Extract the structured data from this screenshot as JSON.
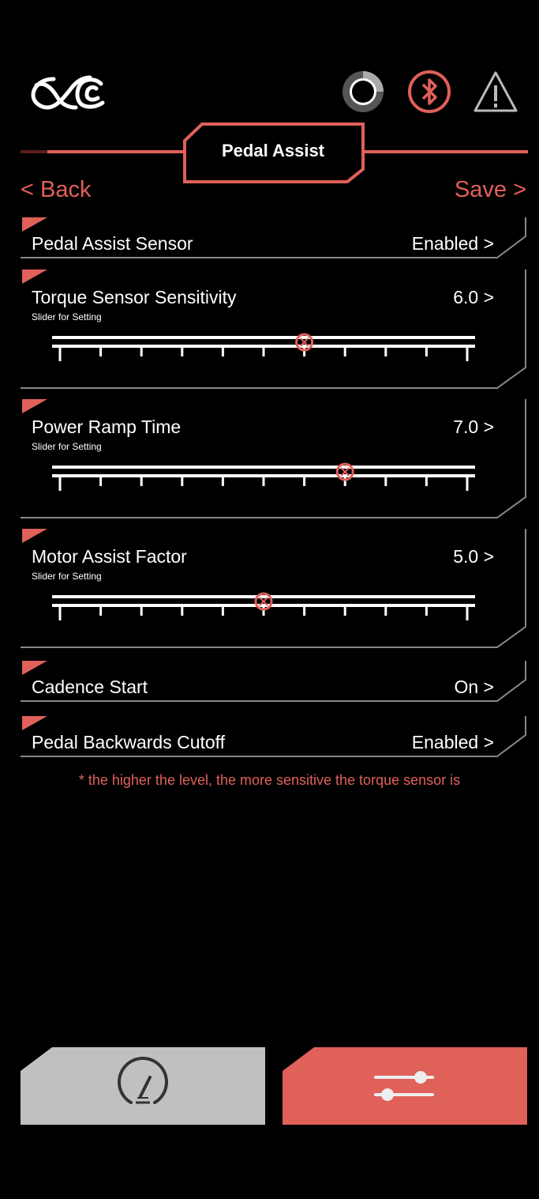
{
  "header": {
    "logo_icon": "cyc-logo-icon",
    "status_icons": [
      "brake-disc-icon",
      "bluetooth-icon",
      "warning-icon"
    ],
    "title": "Pedal Assist"
  },
  "nav": {
    "back_label": "< Back",
    "save_label": "Save >"
  },
  "rows": [
    {
      "label": "Pedal Assist Sensor",
      "value": "Enabled >"
    },
    {
      "label": "Torque Sensor Sensitivity",
      "value": "6.0 >",
      "sub": "Slider for Setting",
      "slider_level": 0.6
    },
    {
      "label": "Power Ramp Time",
      "value": "7.0 >",
      "sub": "Slider for Setting",
      "slider_level": 0.7
    },
    {
      "label": "Motor Assist Factor",
      "value": "5.0 >",
      "sub": "Slider for Setting",
      "slider_level": 0.5
    },
    {
      "label": "Cadence Start",
      "value": "On >"
    },
    {
      "label": "Pedal Backwards Cutoff",
      "value": "Enabled >"
    }
  ],
  "note": "* the higher the level, the more sensitive the torque sensor is",
  "bottom_nav": {
    "left_icon": "speedometer-icon",
    "right_icon": "sliders-icon"
  },
  "colors": {
    "accent": "#e0605a",
    "inactive_button": "#c0c0c0",
    "background": "#000000"
  }
}
